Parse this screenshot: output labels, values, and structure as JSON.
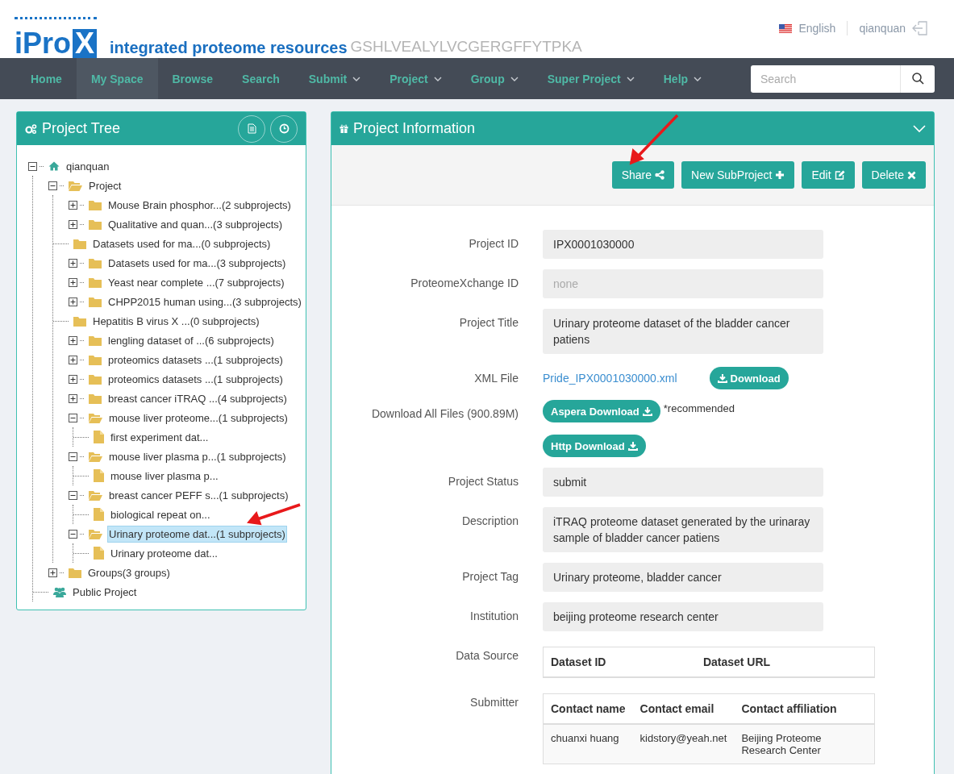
{
  "header": {
    "logo": {
      "mark": "iPro",
      "mark_box": "X",
      "tagline": "integrated proteome resources",
      "banner_sequence": "GSHLVEALYLVCGERGFFYTPKA"
    },
    "language": "English",
    "username": "qianquan"
  },
  "nav": {
    "items": [
      {
        "label": "Home",
        "dropdown": false,
        "selected": false
      },
      {
        "label": "My Space",
        "dropdown": false,
        "selected": true
      },
      {
        "label": "Browse",
        "dropdown": false,
        "selected": false
      },
      {
        "label": "Search",
        "dropdown": false,
        "selected": false
      },
      {
        "label": "Submit",
        "dropdown": true,
        "selected": false
      },
      {
        "label": "Project",
        "dropdown": true,
        "selected": false
      },
      {
        "label": "Group",
        "dropdown": true,
        "selected": false
      },
      {
        "label": "Super Project",
        "dropdown": true,
        "selected": false
      },
      {
        "label": "Help",
        "dropdown": true,
        "selected": false
      }
    ],
    "search": {
      "placeholder": "Search"
    }
  },
  "project_tree": {
    "title": "Project Tree",
    "nodes": [
      {
        "kind": "home",
        "label": "qianquan",
        "expanded": true,
        "selected": false,
        "children": [
          {
            "kind": "folder",
            "label": "Project",
            "expanded": true,
            "selected": false,
            "children": [
              {
                "kind": "folder",
                "label": "Mouse Brain phosphor...(2 subprojects)",
                "expanded": false,
                "selected": false
              },
              {
                "kind": "folder",
                "label": "Qualitative and quan...(3 subprojects)",
                "expanded": false,
                "selected": false
              },
              {
                "kind": "folder",
                "label": "Datasets used for ma...(0 subprojects)",
                "selected": false
              },
              {
                "kind": "folder",
                "label": "Datasets used for ma...(3 subprojects)",
                "expanded": false,
                "selected": false
              },
              {
                "kind": "folder",
                "label": "Yeast near complete ...(7 subprojects)",
                "expanded": false,
                "selected": false
              },
              {
                "kind": "folder",
                "label": "CHPP2015 human using...(3 subprojects)",
                "expanded": false,
                "selected": false
              },
              {
                "kind": "folder",
                "label": "Hepatitis B virus X ...(0 subprojects)",
                "selected": false
              },
              {
                "kind": "folder",
                "label": "lengling dataset of ...(6 subprojects)",
                "expanded": false,
                "selected": false
              },
              {
                "kind": "folder",
                "label": "proteomics datasets ...(1 subprojects)",
                "expanded": false,
                "selected": false
              },
              {
                "kind": "folder",
                "label": "proteomics datasets ...(1 subprojects)",
                "expanded": false,
                "selected": false
              },
              {
                "kind": "folder",
                "label": "breast cancer iTRAQ ...(4 subprojects)",
                "expanded": false,
                "selected": false
              },
              {
                "kind": "folder",
                "label": "mouse liver proteome...(1 subprojects)",
                "expanded": true,
                "selected": false,
                "children": [
                  {
                    "kind": "file",
                    "label": "first experiment dat...",
                    "selected": false
                  }
                ]
              },
              {
                "kind": "folder",
                "label": "mouse liver plasma p...(1 subprojects)",
                "expanded": true,
                "selected": false,
                "children": [
                  {
                    "kind": "file",
                    "label": "mouse liver plasma p...",
                    "selected": false
                  }
                ]
              },
              {
                "kind": "folder",
                "label": "breast cancer PEFF s...(1 subprojects)",
                "expanded": true,
                "selected": false,
                "children": [
                  {
                    "kind": "file",
                    "label": "biological repeat on...",
                    "selected": false
                  }
                ]
              },
              {
                "kind": "folder",
                "label": "Urinary proteome dat...(1 subprojects)",
                "expanded": true,
                "selected": true,
                "children": [
                  {
                    "kind": "file",
                    "label": "Urinary proteome dat...",
                    "selected": false
                  }
                ]
              }
            ]
          },
          {
            "kind": "folder",
            "label": "Groups(3 groups)",
            "expanded": false,
            "selected": false
          },
          {
            "kind": "users",
            "label": "Public Project",
            "selected": false
          }
        ]
      }
    ]
  },
  "project_info": {
    "title": "Project Information",
    "buttons": [
      {
        "label": "Share",
        "kind": "share"
      },
      {
        "label": "New SubProject",
        "kind": "add"
      },
      {
        "label": "Edit",
        "kind": "edit"
      },
      {
        "label": "Delete",
        "kind": "delete"
      }
    ],
    "fields": [
      {
        "kind": "text",
        "label": "Project ID",
        "value": "IPX0001030000",
        "muted": false
      },
      {
        "kind": "text",
        "label": "ProteomeXchange ID",
        "value": "none",
        "muted": true
      },
      {
        "kind": "text",
        "label": "Project Title",
        "value": "Urinary proteome dataset of the bladder cancer patiens",
        "muted": false
      },
      {
        "kind": "link",
        "label": "XML File",
        "link": "Pride_IPX0001030000.xml",
        "button": "Download"
      },
      {
        "kind": "downloads",
        "label": "Download All Files (900.89M)",
        "buttons": [
          "Aspera Download",
          "Http Download"
        ],
        "note": "*recommended"
      },
      {
        "kind": "text",
        "label": "Project Status",
        "value": "submit",
        "muted": false
      },
      {
        "kind": "text",
        "label": "Description",
        "value": "iTRAQ proteome dataset generated by the urinaray sample of bladder cancer patiens",
        "muted": false
      },
      {
        "kind": "text",
        "label": "Project Tag",
        "value": "Urinary proteome, bladder cancer",
        "muted": false
      },
      {
        "kind": "text",
        "label": "Institution",
        "value": "beijing proteome research center",
        "muted": false
      },
      {
        "kind": "table",
        "label": "Data Source",
        "columns": [
          "Dataset ID",
          "Dataset URL"
        ]
      },
      {
        "kind": "table",
        "label": "Submitter",
        "columns": [
          "Contact name",
          "Contact email",
          "Contact affiliation"
        ],
        "rows": [
          [
            "chuanxi huang",
            "kidstory@yeah.net",
            "Beijing Proteome Research Center"
          ]
        ]
      }
    ]
  }
}
